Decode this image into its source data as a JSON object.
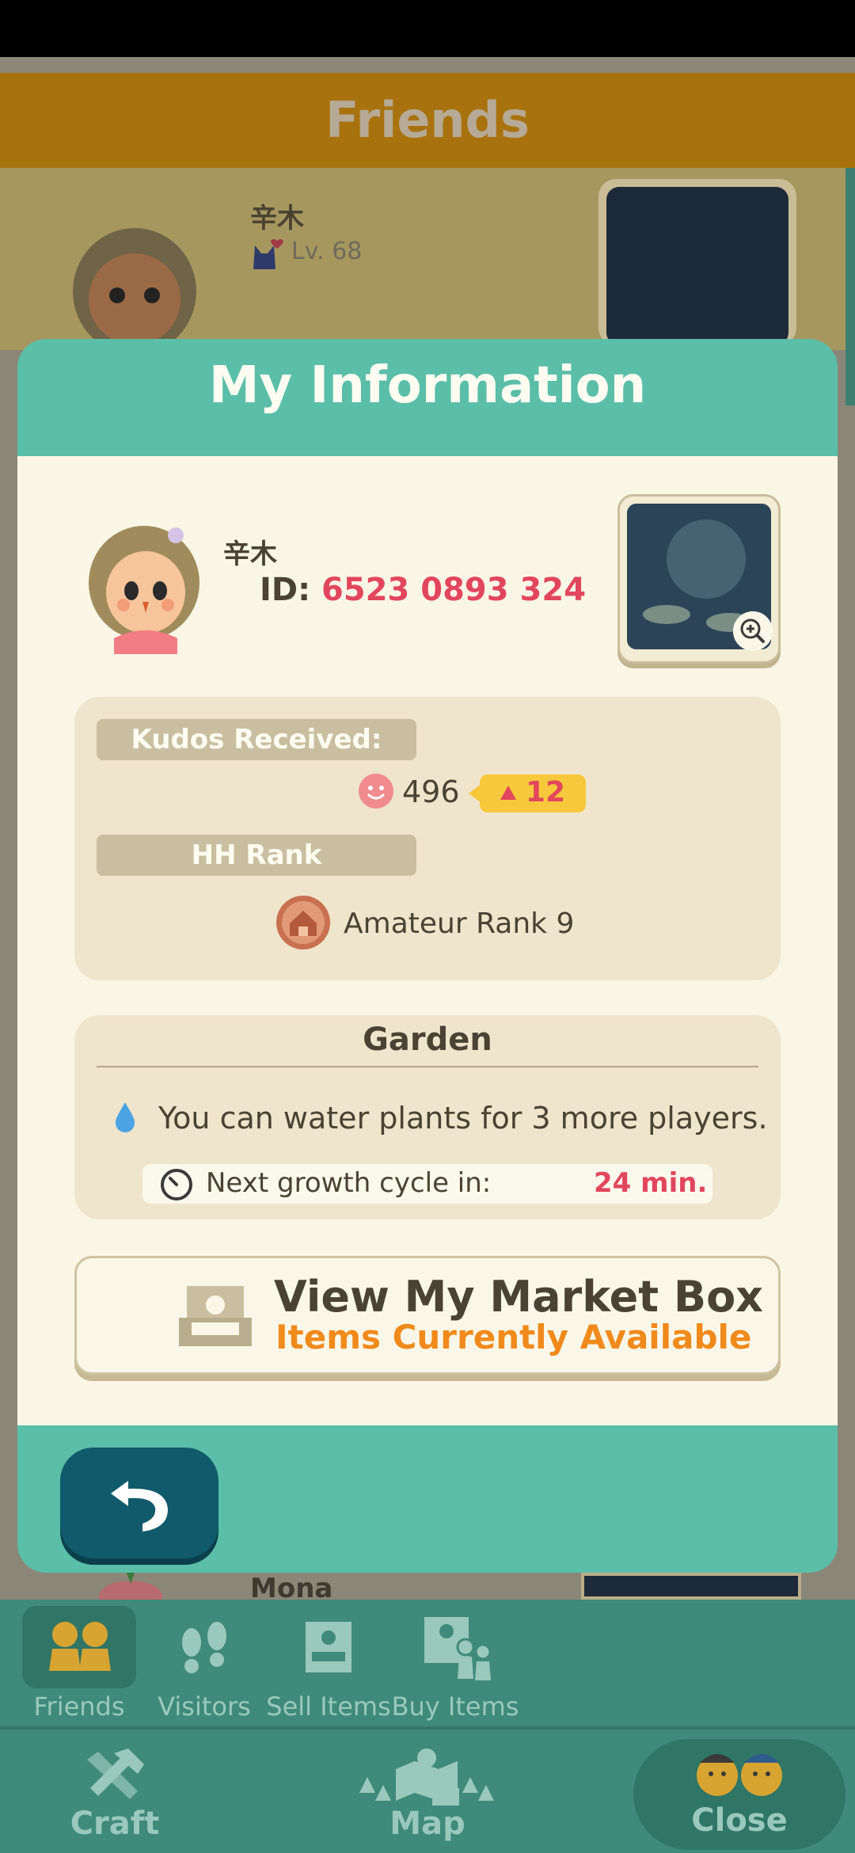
{
  "background": {
    "header_title": "Friends",
    "friend": {
      "name": "辛木",
      "level": "Lv. 68"
    },
    "next_friend": {
      "name": "Mona"
    }
  },
  "modal": {
    "title": "My Information",
    "user": {
      "name": "辛木",
      "id_label": "ID: ",
      "id_value": "6523 0893 324"
    },
    "kudos": {
      "label": "Kudos Received:",
      "count": "496",
      "delta": "12"
    },
    "rank": {
      "label": "HH Rank",
      "value": "Amateur Rank 9"
    },
    "garden": {
      "title": "Garden",
      "water_text": "You can water plants for 3 more players.",
      "growth_label": "Next growth cycle in:",
      "growth_value": "24 min."
    },
    "market": {
      "title": "View My Market Box",
      "subtitle": "Items Currently Available"
    }
  },
  "nav": {
    "tabs": [
      {
        "label": "Friends",
        "icon": "friends-icon",
        "active": true
      },
      {
        "label": "Visitors",
        "icon": "footprints-icon"
      },
      {
        "label": "Sell Items",
        "icon": "market-box-icon"
      },
      {
        "label": "Buy Items",
        "icon": "buy-items-icon"
      }
    ],
    "bottom": {
      "craft": "Craft",
      "map": "Map",
      "close": "Close"
    }
  },
  "colors": {
    "teal": "#5bbea8",
    "cream": "#faf6e5",
    "accent_red": "#e2465e",
    "orange": "#f08a1b",
    "back_button": "#115a6b"
  }
}
